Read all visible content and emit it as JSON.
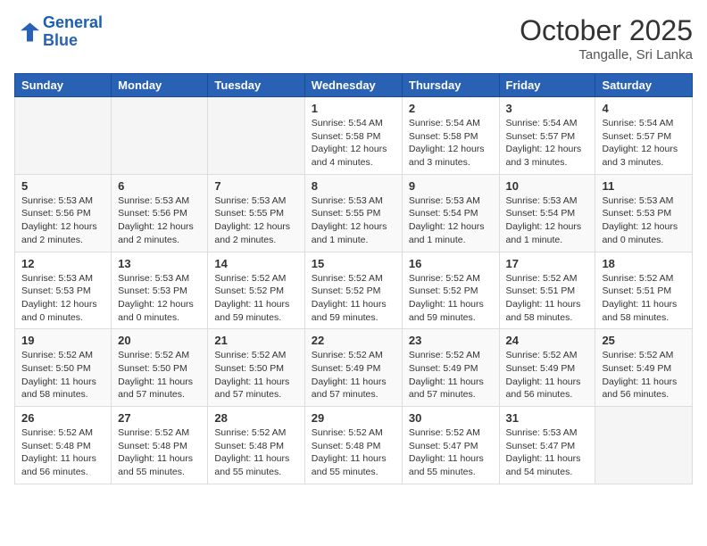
{
  "header": {
    "logo_line1": "General",
    "logo_line2": "Blue",
    "month": "October 2025",
    "location": "Tangalle, Sri Lanka"
  },
  "weekdays": [
    "Sunday",
    "Monday",
    "Tuesday",
    "Wednesday",
    "Thursday",
    "Friday",
    "Saturday"
  ],
  "weeks": [
    [
      {
        "day": "",
        "info": ""
      },
      {
        "day": "",
        "info": ""
      },
      {
        "day": "",
        "info": ""
      },
      {
        "day": "1",
        "info": "Sunrise: 5:54 AM\nSunset: 5:58 PM\nDaylight: 12 hours\nand 4 minutes."
      },
      {
        "day": "2",
        "info": "Sunrise: 5:54 AM\nSunset: 5:58 PM\nDaylight: 12 hours\nand 3 minutes."
      },
      {
        "day": "3",
        "info": "Sunrise: 5:54 AM\nSunset: 5:57 PM\nDaylight: 12 hours\nand 3 minutes."
      },
      {
        "day": "4",
        "info": "Sunrise: 5:54 AM\nSunset: 5:57 PM\nDaylight: 12 hours\nand 3 minutes."
      }
    ],
    [
      {
        "day": "5",
        "info": "Sunrise: 5:53 AM\nSunset: 5:56 PM\nDaylight: 12 hours\nand 2 minutes."
      },
      {
        "day": "6",
        "info": "Sunrise: 5:53 AM\nSunset: 5:56 PM\nDaylight: 12 hours\nand 2 minutes."
      },
      {
        "day": "7",
        "info": "Sunrise: 5:53 AM\nSunset: 5:55 PM\nDaylight: 12 hours\nand 2 minutes."
      },
      {
        "day": "8",
        "info": "Sunrise: 5:53 AM\nSunset: 5:55 PM\nDaylight: 12 hours\nand 1 minute."
      },
      {
        "day": "9",
        "info": "Sunrise: 5:53 AM\nSunset: 5:54 PM\nDaylight: 12 hours\nand 1 minute."
      },
      {
        "day": "10",
        "info": "Sunrise: 5:53 AM\nSunset: 5:54 PM\nDaylight: 12 hours\nand 1 minute."
      },
      {
        "day": "11",
        "info": "Sunrise: 5:53 AM\nSunset: 5:53 PM\nDaylight: 12 hours\nand 0 minutes."
      }
    ],
    [
      {
        "day": "12",
        "info": "Sunrise: 5:53 AM\nSunset: 5:53 PM\nDaylight: 12 hours\nand 0 minutes."
      },
      {
        "day": "13",
        "info": "Sunrise: 5:53 AM\nSunset: 5:53 PM\nDaylight: 12 hours\nand 0 minutes."
      },
      {
        "day": "14",
        "info": "Sunrise: 5:52 AM\nSunset: 5:52 PM\nDaylight: 11 hours\nand 59 minutes."
      },
      {
        "day": "15",
        "info": "Sunrise: 5:52 AM\nSunset: 5:52 PM\nDaylight: 11 hours\nand 59 minutes."
      },
      {
        "day": "16",
        "info": "Sunrise: 5:52 AM\nSunset: 5:52 PM\nDaylight: 11 hours\nand 59 minutes."
      },
      {
        "day": "17",
        "info": "Sunrise: 5:52 AM\nSunset: 5:51 PM\nDaylight: 11 hours\nand 58 minutes."
      },
      {
        "day": "18",
        "info": "Sunrise: 5:52 AM\nSunset: 5:51 PM\nDaylight: 11 hours\nand 58 minutes."
      }
    ],
    [
      {
        "day": "19",
        "info": "Sunrise: 5:52 AM\nSunset: 5:50 PM\nDaylight: 11 hours\nand 58 minutes."
      },
      {
        "day": "20",
        "info": "Sunrise: 5:52 AM\nSunset: 5:50 PM\nDaylight: 11 hours\nand 57 minutes."
      },
      {
        "day": "21",
        "info": "Sunrise: 5:52 AM\nSunset: 5:50 PM\nDaylight: 11 hours\nand 57 minutes."
      },
      {
        "day": "22",
        "info": "Sunrise: 5:52 AM\nSunset: 5:49 PM\nDaylight: 11 hours\nand 57 minutes."
      },
      {
        "day": "23",
        "info": "Sunrise: 5:52 AM\nSunset: 5:49 PM\nDaylight: 11 hours\nand 57 minutes."
      },
      {
        "day": "24",
        "info": "Sunrise: 5:52 AM\nSunset: 5:49 PM\nDaylight: 11 hours\nand 56 minutes."
      },
      {
        "day": "25",
        "info": "Sunrise: 5:52 AM\nSunset: 5:49 PM\nDaylight: 11 hours\nand 56 minutes."
      }
    ],
    [
      {
        "day": "26",
        "info": "Sunrise: 5:52 AM\nSunset: 5:48 PM\nDaylight: 11 hours\nand 56 minutes."
      },
      {
        "day": "27",
        "info": "Sunrise: 5:52 AM\nSunset: 5:48 PM\nDaylight: 11 hours\nand 55 minutes."
      },
      {
        "day": "28",
        "info": "Sunrise: 5:52 AM\nSunset: 5:48 PM\nDaylight: 11 hours\nand 55 minutes."
      },
      {
        "day": "29",
        "info": "Sunrise: 5:52 AM\nSunset: 5:48 PM\nDaylight: 11 hours\nand 55 minutes."
      },
      {
        "day": "30",
        "info": "Sunrise: 5:52 AM\nSunset: 5:47 PM\nDaylight: 11 hours\nand 55 minutes."
      },
      {
        "day": "31",
        "info": "Sunrise: 5:53 AM\nSunset: 5:47 PM\nDaylight: 11 hours\nand 54 minutes."
      },
      {
        "day": "",
        "info": ""
      }
    ]
  ]
}
